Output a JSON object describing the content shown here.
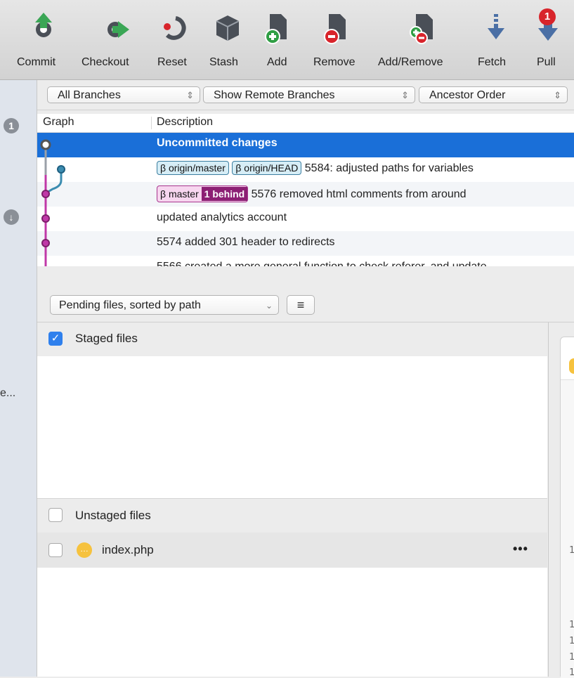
{
  "toolbar": {
    "commit": "Commit",
    "checkout": "Checkout",
    "reset": "Reset",
    "stash": "Stash",
    "add": "Add",
    "remove": "Remove",
    "addremove": "Add/Remove",
    "fetch": "Fetch",
    "pull": "Pull",
    "pull_badge": "1"
  },
  "rail": {
    "badge_top": "1",
    "badge_mid": "↓",
    "truncated_label": "e..."
  },
  "filters": {
    "branches": "All Branches",
    "remote": "Show Remote Branches",
    "order": "Ancestor Order"
  },
  "columns": {
    "graph": "Graph",
    "description": "Description"
  },
  "commits": [
    {
      "desc": "Uncommitted changes"
    },
    {
      "tags": [
        "origin/master",
        "origin/HEAD"
      ],
      "desc": "5584: adjusted paths for  variables"
    },
    {
      "tags": [
        "master"
      ],
      "behind": "1 behind",
      "desc": "5576 removed html comments from around"
    },
    {
      "desc": "updated analytics account"
    },
    {
      "desc": "5574 added 301 header to redirects"
    },
    {
      "desc": "5566 created a more general function to check referer, and update"
    }
  ],
  "pending": {
    "sort_label": "Pending files, sorted by path"
  },
  "staged": {
    "label": "Staged files"
  },
  "unstaged": {
    "label": "Unstaged files",
    "files": [
      {
        "name": "index.php",
        "menu": "•••"
      }
    ]
  },
  "right_pane": {
    "line_numbers": [
      "1",
      "1",
      "1",
      "1",
      "1"
    ]
  },
  "colors": {
    "selection": "#1a6fd8",
    "graph_master": "#c038a8",
    "graph_origin": "#3b8cb0",
    "behind": "#8c1f74"
  }
}
